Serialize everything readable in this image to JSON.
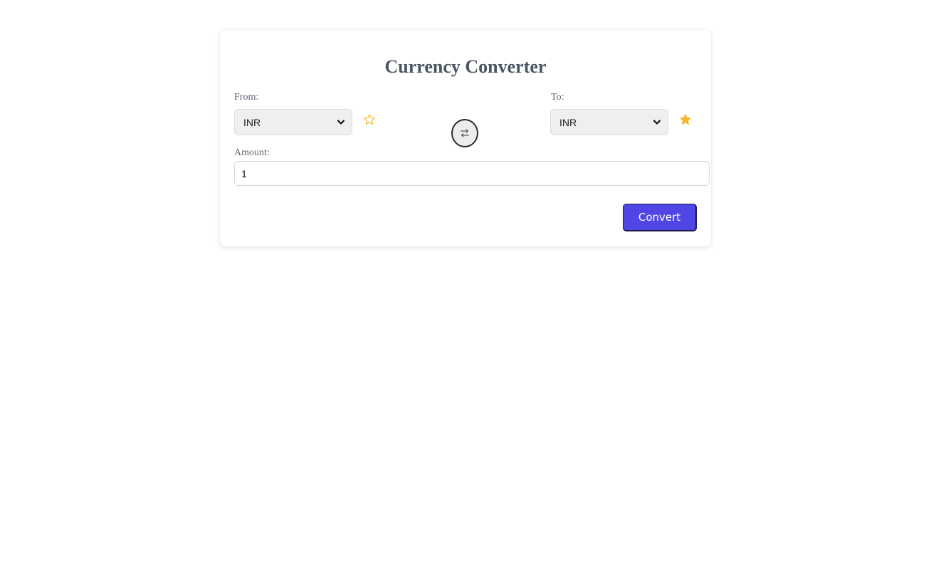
{
  "converter": {
    "title": "Currency Converter",
    "from": {
      "label": "From:",
      "selected": "INR",
      "favorite": false
    },
    "to": {
      "label": "To:",
      "selected": "INR",
      "favorite": true
    },
    "amount": {
      "label": "Amount:",
      "value": "1"
    },
    "convert_label": "Convert",
    "icons": {
      "swap": "swap-arrows-icon",
      "favorite_empty": "star-outline-icon",
      "favorite_filled": "star-filled-icon",
      "dropdown": "chevron-down-icon"
    },
    "colors": {
      "accent": "#4f46e5",
      "star": "#f5b82e",
      "title": "#4a5565"
    }
  }
}
